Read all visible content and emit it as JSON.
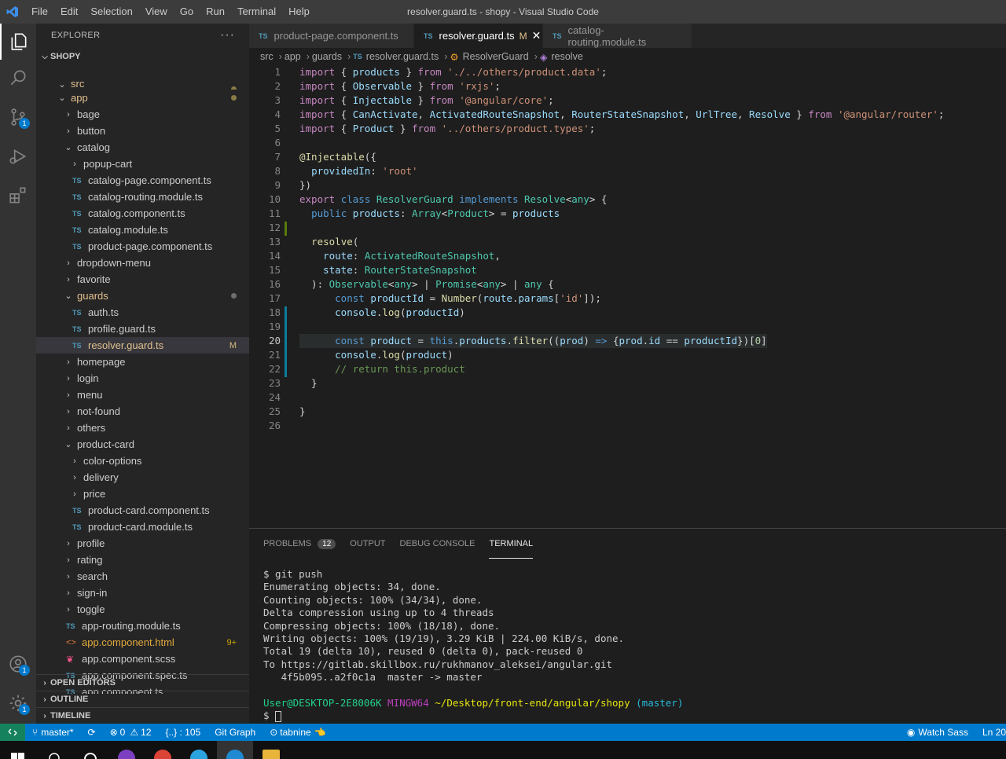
{
  "window": {
    "title": "resolver.guard.ts - shopy - Visual Studio Code",
    "menu": [
      "File",
      "Edit",
      "Selection",
      "View",
      "Go",
      "Run",
      "Terminal",
      "Help"
    ]
  },
  "activity": {
    "source_control_badge": "1",
    "accounts_badge": "1",
    "settings_badge": "1"
  },
  "explorer": {
    "title": "EXPLORER",
    "more": "···",
    "section": "SHOPY",
    "items": [
      {
        "label": "src",
        "indent": 1,
        "type": "folder-open"
      },
      {
        "label": "app",
        "indent": 1,
        "type": "folder-open"
      },
      {
        "label": "bage",
        "indent": 2,
        "type": "folder"
      },
      {
        "label": "button",
        "indent": 2,
        "type": "folder"
      },
      {
        "label": "catalog",
        "indent": 2,
        "type": "folder-open"
      },
      {
        "label": "popup-cart",
        "indent": 3,
        "type": "folder"
      },
      {
        "label": "catalog-page.component.ts",
        "indent": 3,
        "type": "ts"
      },
      {
        "label": "catalog-routing.module.ts",
        "indent": 3,
        "type": "ts"
      },
      {
        "label": "catalog.component.ts",
        "indent": 3,
        "type": "ts"
      },
      {
        "label": "catalog.module.ts",
        "indent": 3,
        "type": "ts"
      },
      {
        "label": "product-page.component.ts",
        "indent": 3,
        "type": "ts"
      },
      {
        "label": "dropdown-menu",
        "indent": 2,
        "type": "folder"
      },
      {
        "label": "favorite",
        "indent": 2,
        "type": "folder"
      },
      {
        "label": "guards",
        "indent": 2,
        "type": "folder-open"
      },
      {
        "label": "auth.ts",
        "indent": 3,
        "type": "ts"
      },
      {
        "label": "profile.guard.ts",
        "indent": 3,
        "type": "ts"
      },
      {
        "label": "resolver.guard.ts",
        "indent": 3,
        "type": "ts"
      },
      {
        "label": "homepage",
        "indent": 2,
        "type": "folder"
      },
      {
        "label": "login",
        "indent": 2,
        "type": "folder"
      },
      {
        "label": "menu",
        "indent": 2,
        "type": "folder"
      },
      {
        "label": "not-found",
        "indent": 2,
        "type": "folder"
      },
      {
        "label": "others",
        "indent": 2,
        "type": "folder"
      },
      {
        "label": "product-card",
        "indent": 2,
        "type": "folder-open"
      },
      {
        "label": "color-options",
        "indent": 3,
        "type": "folder"
      },
      {
        "label": "delivery",
        "indent": 3,
        "type": "folder"
      },
      {
        "label": "price",
        "indent": 3,
        "type": "folder"
      },
      {
        "label": "product-card.component.ts",
        "indent": 3,
        "type": "ts"
      },
      {
        "label": "product-card.module.ts",
        "indent": 3,
        "type": "ts"
      },
      {
        "label": "profile",
        "indent": 2,
        "type": "folder"
      },
      {
        "label": "rating",
        "indent": 2,
        "type": "folder"
      },
      {
        "label": "search",
        "indent": 2,
        "type": "folder"
      },
      {
        "label": "sign-in",
        "indent": 2,
        "type": "folder"
      },
      {
        "label": "toggle",
        "indent": 2,
        "type": "folder"
      },
      {
        "label": "app-routing.module.ts",
        "indent": 2,
        "type": "ts"
      },
      {
        "label": "app.component.html",
        "indent": 2,
        "type": "html"
      },
      {
        "label": "app.component.scss",
        "indent": 2,
        "type": "scss"
      },
      {
        "label": "app.component.spec.ts",
        "indent": 2,
        "type": "ts"
      },
      {
        "label": "app.component.ts",
        "indent": 2,
        "type": "ts"
      }
    ],
    "resolver_mark": "M",
    "html_mark": "9+",
    "open_editors": "OPEN EDITORS",
    "outline": "OUTLINE",
    "timeline": "TIMELINE"
  },
  "tabs": [
    {
      "label": "product-page.component.ts",
      "badge": "TS"
    },
    {
      "label": "resolver.guard.ts",
      "badge": "TS",
      "modified": "M",
      "close": "✕"
    },
    {
      "label": "catalog-routing.module.ts",
      "badge": "TS"
    }
  ],
  "breadcrumb": {
    "src": "src",
    "app": "app",
    "guards": "guards",
    "file": "resolver.guard.ts",
    "class": "ResolverGuard",
    "method": "resolve",
    "ts": "TS",
    "sep": "›"
  },
  "editor": {
    "line_numbers": [
      "1",
      "2",
      "3",
      "4",
      "5",
      "6",
      "7",
      "8",
      "9",
      "10",
      "11",
      "12",
      "13",
      "14",
      "15",
      "16",
      "17",
      "18",
      "19",
      "20",
      "21",
      "22",
      "23",
      "24",
      "25",
      "26"
    ],
    "current_line": "20"
  },
  "panel": {
    "tabs": {
      "problems": "PROBLEMS",
      "problems_count": "12",
      "output": "OUTPUT",
      "debug": "DEBUG CONSOLE",
      "terminal": "TERMINAL"
    },
    "terminal_lines": [
      "$ git push",
      "Enumerating objects: 34, done.",
      "Counting objects: 100% (34/34), done.",
      "Delta compression using up to 4 threads",
      "Compressing objects: 100% (18/18), done.",
      "Writing objects: 100% (19/19), 3.29 KiB | 224.00 KiB/s, done.",
      "Total 19 (delta 10), reused 0 (delta 0), pack-reused 0",
      "To https://gitlab.skillbox.ru/rukhmanov_aleksei/angular.git",
      "   4f5b095..a2f0c1a  master -> master"
    ],
    "prompt": {
      "user": "User@DESKTOP-2E8006K",
      "shell": "MINGW64",
      "path": "~/Desktop/front-end/angular/shopy",
      "branch": "(master)",
      "dollar": "$"
    }
  },
  "status": {
    "branch": "master*",
    "sync": "⟳",
    "errors": "0",
    "warnings": "12",
    "lines": "{..} : 105",
    "git_graph": "Git Graph",
    "tabnine": "tabnine",
    "watch_sass": "Watch Sass",
    "position": "Ln 20"
  }
}
